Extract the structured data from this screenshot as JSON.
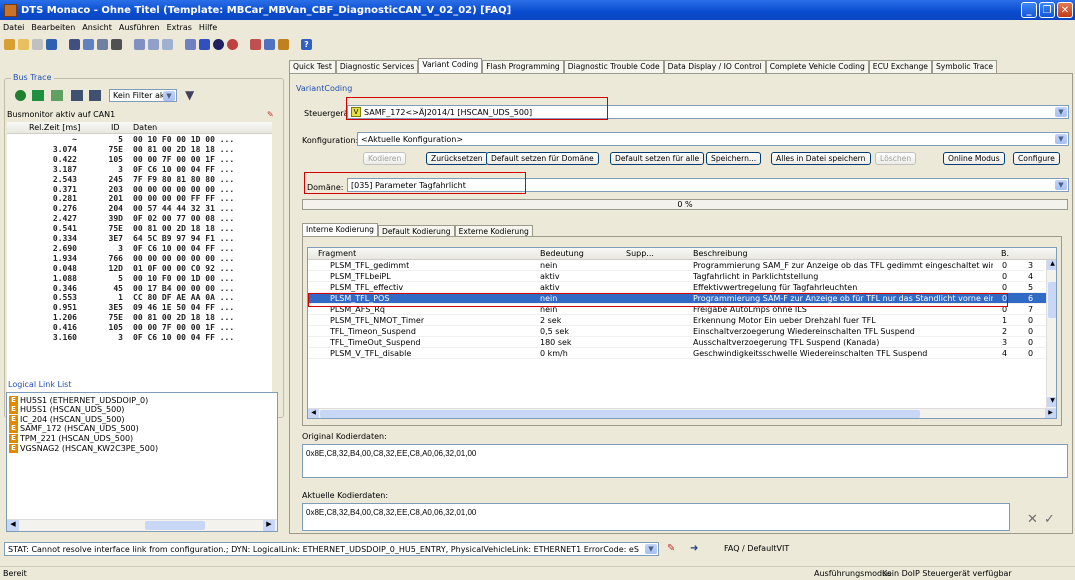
{
  "window": {
    "title": "DTS Monaco - Ohne Titel (Template: MBCar_MBVan_CBF_DiagnosticCAN_V_02_02) [FAQ]"
  },
  "menu": [
    "Datei",
    "Bearbeiten",
    "Ansicht",
    "Ausführen",
    "Extras",
    "Hilfe"
  ],
  "bus_trace": {
    "group_label": "Bus Trace",
    "filter_value": "Kein Filter aktiv",
    "status": "Busmonitor aktiv auf CAN1",
    "columns": [
      "Rel.Zeit [ms]",
      "ID",
      "Daten"
    ],
    "rows": [
      [
        "~",
        "5",
        "00 10 F0 00 1D 00 ..."
      ],
      [
        "3.074",
        "75E",
        "00 81 00 2D 18 18 ..."
      ],
      [
        "0.422",
        "105",
        "00 00 7F 00 00 1F ..."
      ],
      [
        "3.187",
        "3",
        "0F C6 10 00 04 FF ..."
      ],
      [
        "2.543",
        "245",
        "7F F9 80 81 80 80 ..."
      ],
      [
        "0.371",
        "203",
        "00 00 00 00 00 00 ..."
      ],
      [
        "0.281",
        "201",
        "00 00 00 00 FF FF ..."
      ],
      [
        "0.276",
        "204",
        "00 57 44 44 32 31 ..."
      ],
      [
        "2.427",
        "39D",
        "0F 02 00 77 00 08 ..."
      ],
      [
        "0.541",
        "75E",
        "00 81 00 2D 18 18 ..."
      ],
      [
        "0.334",
        "3E7",
        "64 5C B9 97 94 F1 ..."
      ],
      [
        "2.690",
        "3",
        "0F C6 10 00 04 FF ..."
      ],
      [
        "1.934",
        "766",
        "00 00 00 00 00 00 ..."
      ],
      [
        "0.048",
        "12D",
        "01 0F 00 00 C0 92 ..."
      ],
      [
        "1.088",
        "5",
        "00 10 F0 00 1D 00 ..."
      ],
      [
        "0.346",
        "45",
        "00 17 B4 00 00 00 ..."
      ],
      [
        "0.553",
        "1",
        "CC 80 DF AE AA 0A ..."
      ],
      [
        "0.951",
        "3E5",
        "09 46 1E 50 04 FF ..."
      ],
      [
        "1.206",
        "75E",
        "00 81 00 2D 18 18 ..."
      ],
      [
        "0.416",
        "105",
        "00 00 7F 00 00 1F ..."
      ],
      [
        "3.160",
        "3",
        "0F C6 10 00 04 FF ..."
      ]
    ]
  },
  "logical_links": {
    "group_label": "Logical Link List",
    "items": [
      "HU5S1 (ETHERNET_UDSDOIP_0)",
      "HU5S1 (HSCAN_UDS_500)",
      "IC_204 (HSCAN_UDS_500)",
      "SAMF_172 (HSCAN_UDS_500)",
      "TPM_221 (HSCAN_UDS_500)",
      "VGSNAG2 (HSCAN_KW2C3PE_500)"
    ]
  },
  "tabs": [
    "Quick Test",
    "Diagnostic Services",
    "Variant Coding",
    "Flash Programming",
    "Diagnostic Trouble Code",
    "Data Display / IO Control",
    "Complete Vehicle Coding",
    "ECU Exchange",
    "Symbolic Trace"
  ],
  "variant_coding": {
    "group_label": "VariantCoding",
    "steuergeraet_label": "Steuergerät:",
    "steuergeraet_value": "SAMF_172<>ÄJ2014/1 [HSCAN_UDS_500]",
    "steuergeraet_badge": "V",
    "konfiguration_label": "Konfiguration:",
    "konfiguration_value": "<Aktuelle Konfiguration>",
    "buttons": [
      "Kodieren",
      "Zurücksetzen",
      "Default setzen für Domäne",
      "Default setzen für alle",
      "Speichern...",
      "Alles in Datei speichern",
      "Löschen",
      "Online Modus",
      "Configure"
    ],
    "domaene_label": "Domäne:",
    "domaene_value": "[035] Parameter Tagfahrlicht",
    "progress_text": "0 %",
    "progress": 0,
    "subtabs": [
      "Interne Kodierung",
      "Default Kodierung",
      "Externe Kodierung"
    ],
    "columns": [
      "Fragment",
      "Bedeutung",
      "Supp...",
      "Beschreibung",
      "B."
    ],
    "rows": [
      [
        "PLSM_TFL_gedimmt",
        "nein",
        "",
        "Programmierung SAM_F zur Anzeige ob das TFL gedimmt eingeschaltet wird",
        "0",
        "3"
      ],
      [
        "PLSM_TFLbeiPL",
        "aktiv",
        "",
        "Tagfahrlicht in Parklichtstellung",
        "0",
        "4"
      ],
      [
        "PLSM_TFL_effectiv",
        "aktiv",
        "",
        "Effektivwertregelung für Tagfahrleuchten",
        "0",
        "5"
      ],
      [
        "PLSM_TFL_POS",
        "nein",
        "",
        "Programmierung SAM-F zur Anzeige ob für TFL nur das Standlicht vorne eing...",
        "0",
        "6"
      ],
      [
        "PLSM_AFS_Rq",
        "nein",
        "",
        "Freigabe AutoLmps ohne ILS",
        "0",
        "7"
      ],
      [
        "PLSM_TFL_NMOT_Timer",
        "2 sek",
        "",
        "Erkennung Motor Ein ueber Drehzahl fuer TFL",
        "1",
        "0"
      ],
      [
        "TFL_Timeon_Suspend",
        "0,5 sek",
        "",
        "Einschaltverzoegerung Wiedereinschalten TFL Suspend",
        "2",
        "0"
      ],
      [
        "TFL_TimeOut_Suspend",
        "180 sek",
        "",
        "Ausschaltverzoegerung TFL Suspend (Kanada)",
        "3",
        "0"
      ],
      [
        "PLSM_V_TFL_disable",
        "0 km/h",
        "",
        "Geschwindigkeitsschwelle Wiedereinschalten TFL Suspend",
        "4",
        "0"
      ]
    ],
    "original_label": "Original Kodierdaten:",
    "original_value": "0x8E,C8,32,B4,00,C8,32,EE,C8,A0,06,32,01,00",
    "aktuelle_label": "Aktuelle Kodierdaten:",
    "aktuelle_value": "0x8E,C8,32,B4,00,C8,32,EE,C8,A0,06,32,01,00"
  },
  "status_line": {
    "text": "STAT: Cannot resolve interface link from configuration.; DYN: LogicalLink: ETHERNET_UDSDOIP_0_HU5_ENTRY, PhysicalVehicleLink: ETHERNET1 ErrorCode: eS",
    "faq": "FAQ / DefaultVIT"
  },
  "bottom": {
    "left": "Bereit",
    "right1": "Ausführungsmodus",
    "right2": "Kein DoIP Steuergerät verfügbar"
  }
}
